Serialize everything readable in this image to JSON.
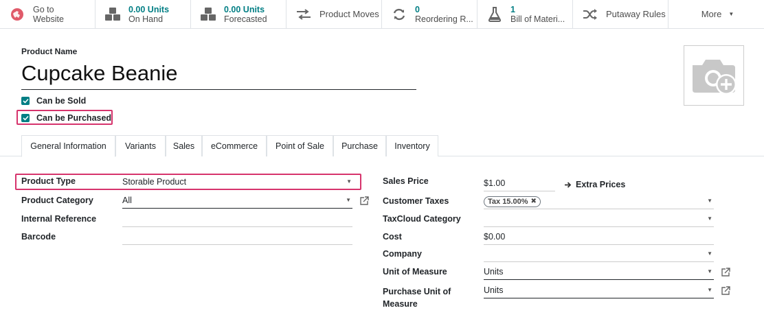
{
  "smart_buttons": {
    "go_to_website": {
      "line1": "Go to",
      "line2": "Website"
    },
    "on_hand": {
      "value": "0.00 Units",
      "label": "On Hand"
    },
    "forecasted": {
      "value": "0.00 Units",
      "label": "Forecasted"
    },
    "product_moves": {
      "label": "Product Moves"
    },
    "reordering_rules": {
      "value": "0",
      "label": "Reordering R..."
    },
    "bill_of_materials": {
      "value": "1",
      "label": "Bill of Materi..."
    },
    "putaway_rules": {
      "label": "Putaway Rules"
    },
    "more": {
      "label": "More"
    }
  },
  "product": {
    "name_label": "Product Name",
    "name": "Cupcake Beanie",
    "can_be_sold": "Can be Sold",
    "can_be_purchased": "Can be Purchased"
  },
  "tabs": [
    "General Information",
    "Variants",
    "Sales",
    "eCommerce",
    "Point of Sale",
    "Purchase",
    "Inventory"
  ],
  "form_left": {
    "product_type": {
      "label": "Product Type",
      "value": "Storable Product"
    },
    "product_category": {
      "label": "Product Category",
      "value": "All"
    },
    "internal_reference": {
      "label": "Internal Reference",
      "value": ""
    },
    "barcode": {
      "label": "Barcode",
      "value": ""
    }
  },
  "form_right": {
    "sales_price": {
      "label": "Sales Price",
      "value": "$1.00"
    },
    "extra_prices": "Extra Prices",
    "customer_taxes": {
      "label": "Customer Taxes",
      "tag": "Tax 15.00%"
    },
    "taxcloud_category": {
      "label": "TaxCloud Category",
      "value": ""
    },
    "cost": {
      "label": "Cost",
      "value": "$0.00"
    },
    "company": {
      "label": "Company",
      "value": ""
    },
    "unit_of_measure": {
      "label": "Unit of Measure",
      "value": "Units"
    },
    "purchase_uom": {
      "label_line1": "Purchase Unit of",
      "label_line2": "Measure",
      "value": "Units"
    }
  },
  "colors": {
    "accent": "#017e84",
    "highlight": "#d6336c"
  }
}
